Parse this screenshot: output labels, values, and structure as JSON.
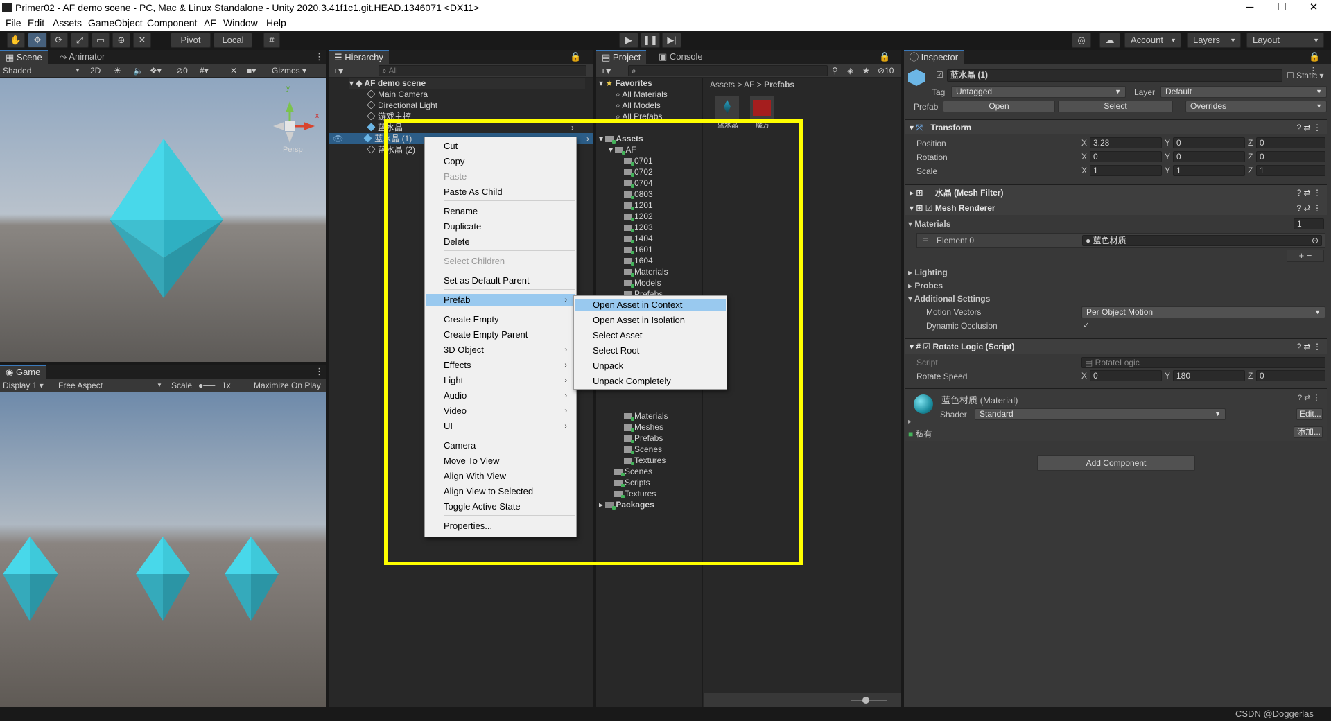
{
  "window": {
    "title": "Primer02 - AF demo scene - PC, Mac & Linux Standalone - Unity 2020.3.41f1c1.git.HEAD.1346071 <DX11>",
    "minimize": "─",
    "maximize": "☐",
    "close": "✕"
  },
  "menubar": [
    "File",
    "Edit",
    "Assets",
    "GameObject",
    "Component",
    "AF",
    "Window",
    "Help"
  ],
  "toolbar": {
    "pivot": "Pivot",
    "local": "Local",
    "account": "Account",
    "layers": "Layers",
    "layout": "Layout"
  },
  "scene": {
    "tabs": [
      "Scene",
      "Animator"
    ],
    "shading": "Shaded",
    "mode_2d": "2D",
    "hidden_count": "0",
    "gizmos": "Gizmos",
    "persp": "Persp",
    "axis_y": "y",
    "axis_x": "x"
  },
  "game": {
    "tab": "Game",
    "display": "Display 1",
    "aspect": "Free Aspect",
    "scale_label": "Scale",
    "scale_value": "1x",
    "maximize": "Maximize On Play"
  },
  "hierarchy": {
    "tab": "Hierarchy",
    "search_placeholder": "All",
    "scene_name": "AF demo scene",
    "items": [
      "Main Camera",
      "Directional Light",
      "游戏主控",
      "蓝水晶",
      "蓝水晶 (1)",
      "蓝水晶 (2)"
    ]
  },
  "project": {
    "tabs": [
      "Project",
      "Console"
    ],
    "hidden_count": "10",
    "favorites_label": "Favorites",
    "favorites": [
      "All Materials",
      "All Models",
      "All Prefabs"
    ],
    "assets_label": "Assets",
    "af_label": "AF",
    "af_folders": [
      "0701",
      "0702",
      "0704",
      "0803",
      "1201",
      "1202",
      "1203",
      "1404",
      "1601",
      "1604",
      "Materials",
      "Models",
      "Prefabs"
    ],
    "lower_folders": [
      "Materials",
      "Meshes",
      "Prefabs",
      "Scenes",
      "Textures"
    ],
    "root_folders": [
      "Scenes",
      "Scripts",
      "Textures"
    ],
    "packages": "Packages",
    "breadcrumb": [
      "Assets",
      "AF",
      "Prefabs"
    ],
    "thumbs": [
      "蓝水晶",
      "魔方"
    ]
  },
  "context_menu": {
    "items": [
      {
        "label": "Cut",
        "disabled": false,
        "arrow": ""
      },
      {
        "label": "Copy",
        "disabled": false,
        "arrow": ""
      },
      {
        "label": "Paste",
        "disabled": true,
        "arrow": ""
      },
      {
        "label": "Paste As Child",
        "disabled": false,
        "arrow": ""
      },
      {
        "label": "Rename",
        "disabled": false,
        "arrow": ""
      },
      {
        "label": "Duplicate",
        "disabled": false,
        "arrow": ""
      },
      {
        "label": "Delete",
        "disabled": false,
        "arrow": ""
      },
      {
        "label": "Select Children",
        "disabled": true,
        "arrow": ""
      },
      {
        "label": "Set as Default Parent",
        "disabled": false,
        "arrow": ""
      },
      {
        "label": "Prefab",
        "disabled": false,
        "arrow": "›"
      },
      {
        "label": "Create Empty",
        "disabled": false,
        "arrow": ""
      },
      {
        "label": "Create Empty Parent",
        "disabled": false,
        "arrow": ""
      },
      {
        "label": "3D Object",
        "disabled": false,
        "arrow": "›"
      },
      {
        "label": "Effects",
        "disabled": false,
        "arrow": "›"
      },
      {
        "label": "Light",
        "disabled": false,
        "arrow": "›"
      },
      {
        "label": "Audio",
        "disabled": false,
        "arrow": "›"
      },
      {
        "label": "Video",
        "disabled": false,
        "arrow": "›"
      },
      {
        "label": "UI",
        "disabled": false,
        "arrow": "›"
      },
      {
        "label": "Camera",
        "disabled": false,
        "arrow": ""
      },
      {
        "label": "Move To View",
        "disabled": false,
        "arrow": ""
      },
      {
        "label": "Align With View",
        "disabled": false,
        "arrow": ""
      },
      {
        "label": "Align View to Selected",
        "disabled": false,
        "arrow": ""
      },
      {
        "label": "Toggle Active State",
        "disabled": false,
        "arrow": ""
      },
      {
        "label": "Properties...",
        "disabled": false,
        "arrow": ""
      }
    ]
  },
  "prefab_submenu": [
    "Open Asset in Context",
    "Open Asset in Isolation",
    "Select Asset",
    "Select Root",
    "Unpack",
    "Unpack Completely"
  ],
  "inspector": {
    "tab": "Inspector",
    "object_name": "蓝水晶 (1)",
    "static": "Static",
    "tag_label": "Tag",
    "tag": "Untagged",
    "layer_label": "Layer",
    "layer": "Default",
    "prefab_label": "Prefab",
    "open": "Open",
    "select": "Select",
    "overrides": "Overrides",
    "transform": {
      "title": "Transform",
      "rows": [
        {
          "label": "Position",
          "x": "3.28",
          "y": "0",
          "z": "0"
        },
        {
          "label": "Rotation",
          "x": "0",
          "y": "0",
          "z": "0"
        },
        {
          "label": "Scale",
          "x": "1",
          "y": "1",
          "z": "1"
        }
      ]
    },
    "mesh_filter": "水晶 (Mesh Filter)",
    "mesh_renderer": "Mesh Renderer",
    "materials_label": "Materials",
    "materials_count": "1",
    "element0_label": "Element 0",
    "element0": "蓝色材质",
    "lighting": "Lighting",
    "probes": "Probes",
    "additional": "Additional Settings",
    "motion_vectors_label": "Motion Vectors",
    "motion_vectors": "Per Object Motion",
    "dynamic_occlusion": "Dynamic Occlusion",
    "rotate_logic": "Rotate Logic (Script)",
    "script_label": "Script",
    "script": "RotateLogic",
    "rotate_speed_label": "Rotate Speed",
    "rs_x": "0",
    "rs_y": "180",
    "rs_z": "0",
    "material_name": "蓝色材质 (Material)",
    "shader_label": "Shader",
    "shader": "Standard",
    "edit": "Edit...",
    "private_label": "私有",
    "add_label": "添加...",
    "add_component": "Add Component"
  },
  "watermark": "CSDN @Doggerlas"
}
